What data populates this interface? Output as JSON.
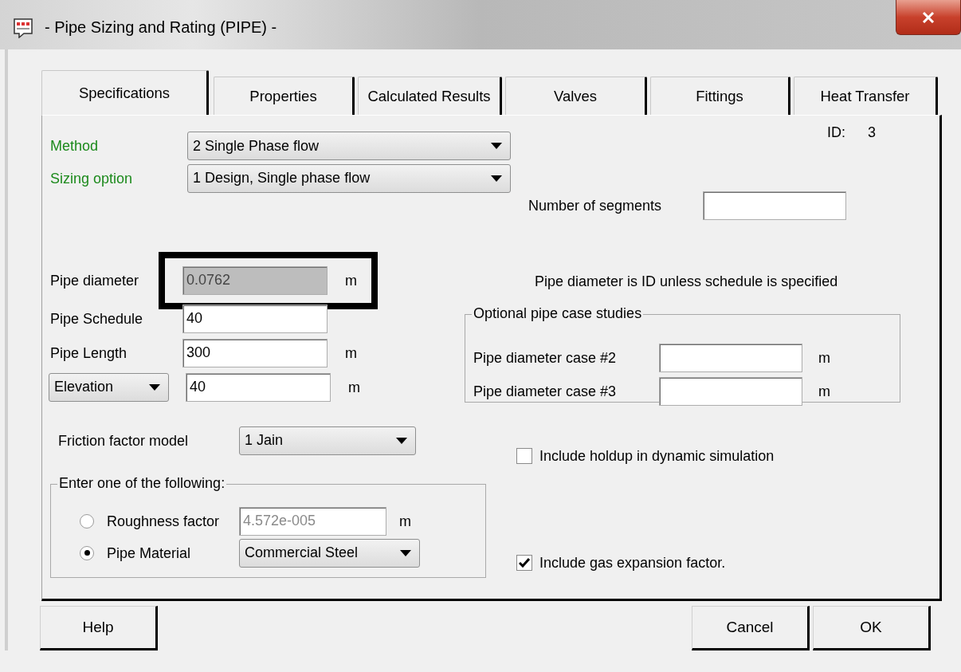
{
  "window": {
    "title": "- Pipe Sizing and Rating (PIPE) -"
  },
  "tabs": [
    {
      "label": "Specifications",
      "selected": true
    },
    {
      "label": "Properties",
      "selected": false
    },
    {
      "label": "Calculated Results",
      "selected": false
    },
    {
      "label": "Valves",
      "selected": false
    },
    {
      "label": "Fittings",
      "selected": false
    },
    {
      "label": "Heat Transfer",
      "selected": false
    }
  ],
  "id": {
    "label": "ID:",
    "value": "3"
  },
  "method": {
    "label": "Method",
    "value": "2 Single Phase flow"
  },
  "sizing_option": {
    "label": "Sizing option",
    "value": "1 Design, Single phase flow"
  },
  "segments": {
    "label": "Number of segments"
  },
  "pipe_fields": [
    {
      "label": "Pipe diameter",
      "value": "0.0762",
      "unit": "m",
      "disabled": true,
      "highlighted": true
    },
    {
      "label": "Pipe Schedule",
      "value": "40",
      "disabled": false
    },
    {
      "label": "Pipe Length",
      "value": "300",
      "unit": "m",
      "disabled": false
    }
  ],
  "elevation": {
    "option": "Elevation",
    "value": "40",
    "unit": "m"
  },
  "note": "Pipe diameter is ID unless schedule is specified",
  "case_studies": {
    "title": "Optional pipe case studies",
    "rows": [
      {
        "label": "Pipe diameter case #2",
        "unit": "m"
      },
      {
        "label": "Pipe diameter case #3",
        "unit": "m"
      }
    ]
  },
  "friction_model": {
    "label": "Friction factor model",
    "value": "1 Jain"
  },
  "roughness_group": {
    "title": "Enter one of the following:",
    "options": [
      {
        "kind": "field",
        "label": "Roughness factor",
        "selected": false,
        "value": "4.572e-005",
        "unit": "m"
      },
      {
        "kind": "dropdown",
        "label": "Pipe Material",
        "selected": true,
        "value": "Commercial Steel"
      }
    ]
  },
  "checkboxes": [
    {
      "label": "Include holdup in dynamic simulation",
      "checked": false
    },
    {
      "label": "Include gas expansion factor.",
      "checked": true
    }
  ],
  "buttons": [
    {
      "label": "Help",
      "kind": "left"
    },
    {
      "label": "Cancel",
      "kind": "right"
    },
    {
      "label": "OK",
      "kind": "right"
    }
  ]
}
